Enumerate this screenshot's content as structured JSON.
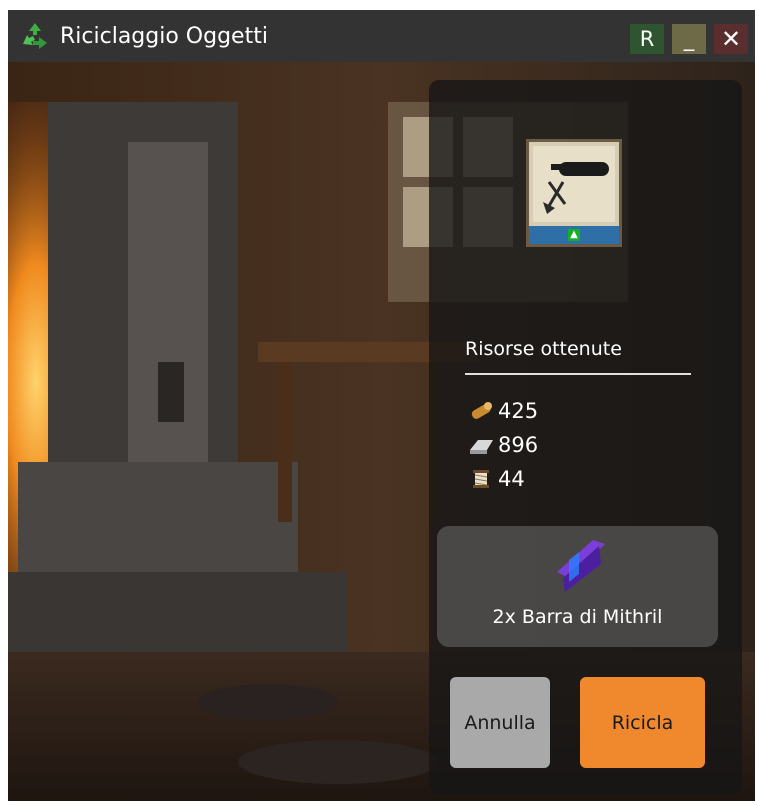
{
  "window": {
    "title": "Riciclaggio Oggetti",
    "title_icon": "recycle-icon",
    "buttons": {
      "reset": "R",
      "minimize": "_",
      "close": "✕"
    }
  },
  "resources": {
    "title": "Risorse ottenute",
    "items": [
      {
        "icon": "wood-log-icon",
        "value": "425"
      },
      {
        "icon": "metal-ingot-icon",
        "value": "896"
      },
      {
        "icon": "thread-spool-icon",
        "value": "44"
      }
    ]
  },
  "recycled_item": {
    "icon": "blueprint-item-icon",
    "upgrade_icon": "arrow-up-icon"
  },
  "output": {
    "icon": "mithril-bar-icon",
    "label": "2x Barra di Mithril"
  },
  "actions": {
    "cancel": "Annulla",
    "recycle": "Ricicla"
  },
  "colors": {
    "recycle_button": "#f0892d",
    "cancel_button": "#a9a9a9",
    "titlebar": "#333333",
    "reset_button": "#2e5530"
  }
}
